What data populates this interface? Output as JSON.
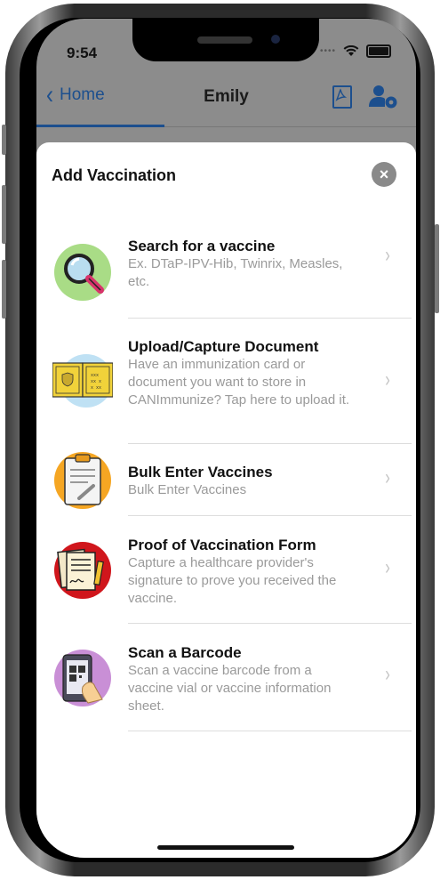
{
  "status_bar": {
    "time": "9:54"
  },
  "nav": {
    "back_label": "Home",
    "title": "Emily",
    "pdf_icon": "pdf-icon",
    "settings_icon": "user-settings-icon"
  },
  "sheet": {
    "title": "Add Vaccination",
    "close_icon": "close-icon",
    "items": [
      {
        "title": "Search for a vaccine",
        "subtitle": "Ex. DTaP-IPV-Hib, Twinrix, Measles, etc.",
        "icon": "magnifier-icon",
        "icon_bg": "#a9dc86"
      },
      {
        "title": "Upload/Capture Document",
        "subtitle": "Have an immunization card or document you want to store in CANImmunize? Tap here to upload it.",
        "icon": "immunization-card-icon",
        "icon_bg": "#bfe1f4"
      },
      {
        "title": "Bulk Enter Vaccines",
        "subtitle": "Bulk Enter Vaccines",
        "icon": "clipboard-icon",
        "icon_bg": "#f5a623"
      },
      {
        "title": "Proof of Vaccination Form",
        "subtitle": "Capture a healthcare provider's signature to prove you received the vaccine.",
        "icon": "signed-form-icon",
        "icon_bg": "#d0161c"
      },
      {
        "title": "Scan a Barcode",
        "subtitle": "Scan a vaccine barcode from a vaccine vial or vaccine information sheet.",
        "icon": "qr-scan-phone-icon",
        "icon_bg": "#c98fd6"
      }
    ]
  },
  "colors": {
    "accent": "#1c4f8e",
    "subtitle": "#9a9a9a"
  }
}
